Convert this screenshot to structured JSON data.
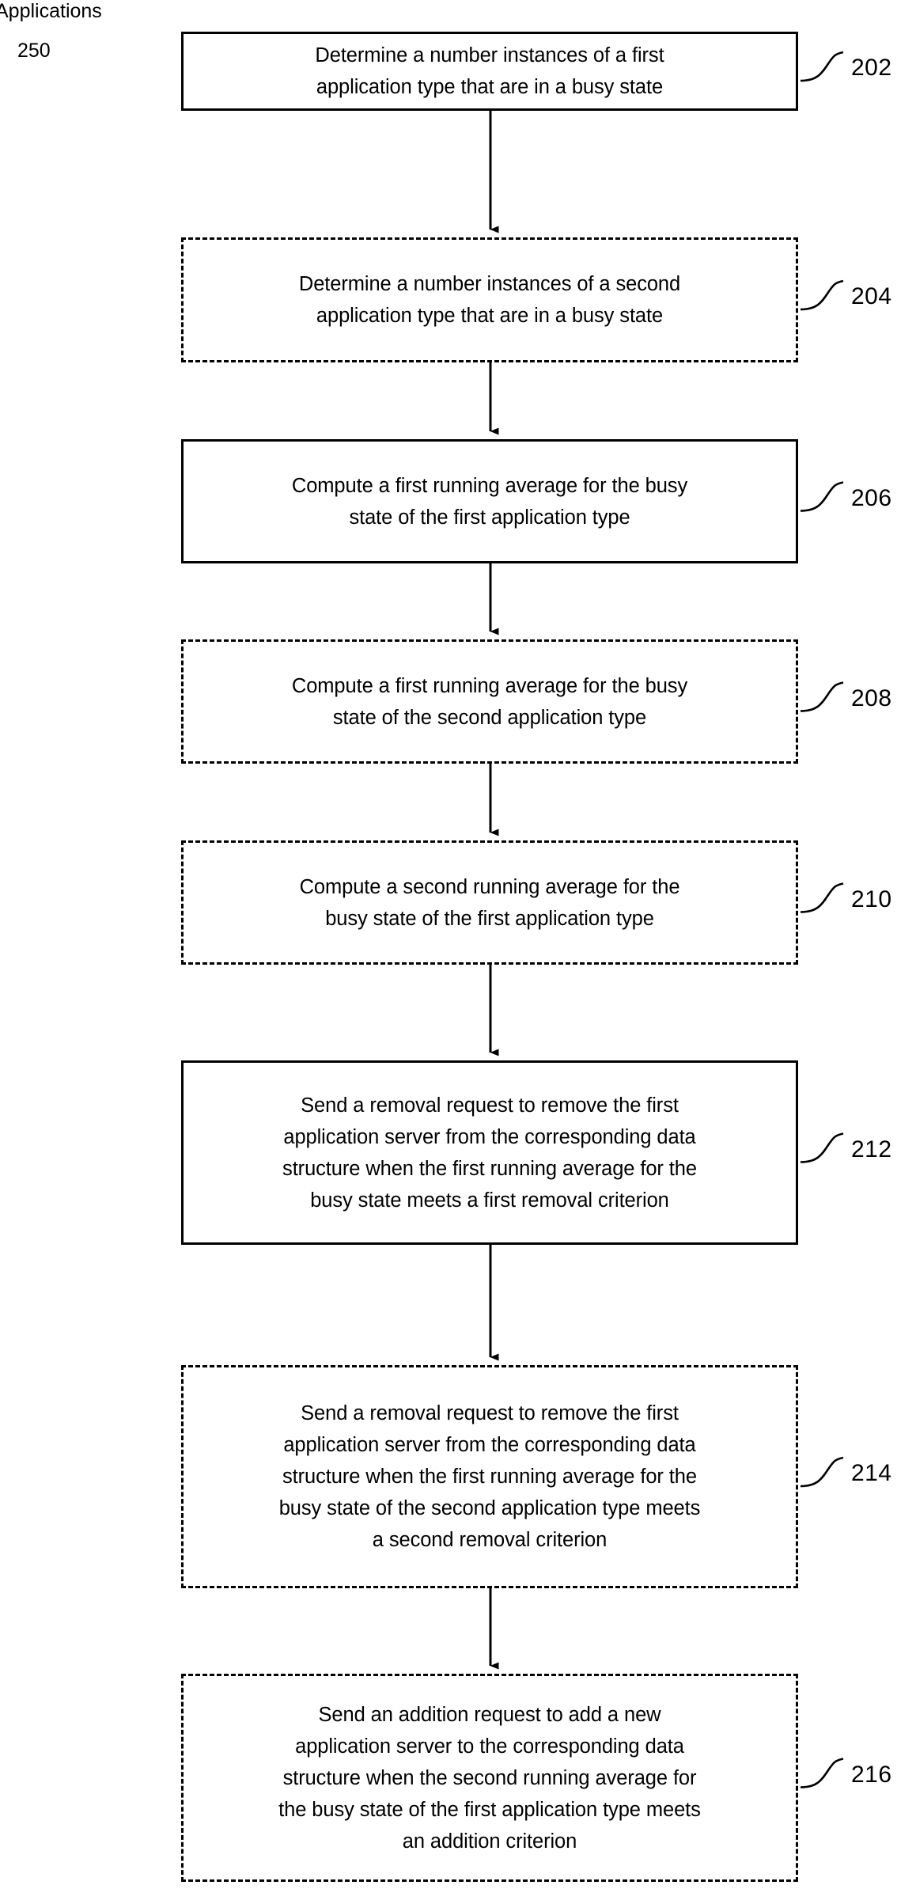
{
  "figure": {
    "title_label": "Applications",
    "figure_reference": "250",
    "background_color": "#ffffff",
    "line_color": "#000000",
    "type": "patent-flowchart"
  },
  "steps": [
    {
      "ref": "202",
      "border": "solid",
      "text": "Determine a number instances of a first\napplication type that are in a busy state",
      "lines": 2
    },
    {
      "ref": "204",
      "border": "dashed",
      "text": "Determine a number instances of a second\napplication type that are in a busy state",
      "lines": 2
    },
    {
      "ref": "206",
      "border": "solid",
      "text": "Compute a first running average for the busy\nstate of the first application type",
      "lines": 2
    },
    {
      "ref": "208",
      "border": "dashed",
      "text": "Compute a first running average for the busy\nstate of the second application type",
      "lines": 2
    },
    {
      "ref": "210",
      "border": "dashed",
      "text": "Compute a second running average for the\nbusy state of the first application type",
      "lines": 2
    },
    {
      "ref": "212",
      "border": "solid",
      "text": "Send a removal request to remove the first\napplication server from the corresponding data\nstructure when the first running average for the\nbusy state meets a first removal criterion",
      "lines": 4
    },
    {
      "ref": "214",
      "border": "dashed",
      "text": "Send a removal request to remove the first\napplication server from the corresponding data\nstructure when the first running average for the\nbusy state of the second application type meets\na second removal criterion",
      "lines": 5
    },
    {
      "ref": "216",
      "border": "dashed",
      "text": "Send an addition request to add a new\napplication server to the corresponding data\nstructure when the second running average for\nthe busy state of the first application type meets\nan addition criterion",
      "lines": 5
    }
  ],
  "connectors": [
    {
      "from": "202",
      "to": "204",
      "style": "arrow-down"
    },
    {
      "from": "204",
      "to": "206",
      "style": "arrow-down"
    },
    {
      "from": "206",
      "to": "208",
      "style": "arrow-down"
    },
    {
      "from": "208",
      "to": "210",
      "style": "arrow-down"
    },
    {
      "from": "210",
      "to": "212",
      "style": "arrow-down"
    },
    {
      "from": "212",
      "to": "214",
      "style": "arrow-down"
    },
    {
      "from": "214",
      "to": "216",
      "style": "arrow-down"
    }
  ]
}
